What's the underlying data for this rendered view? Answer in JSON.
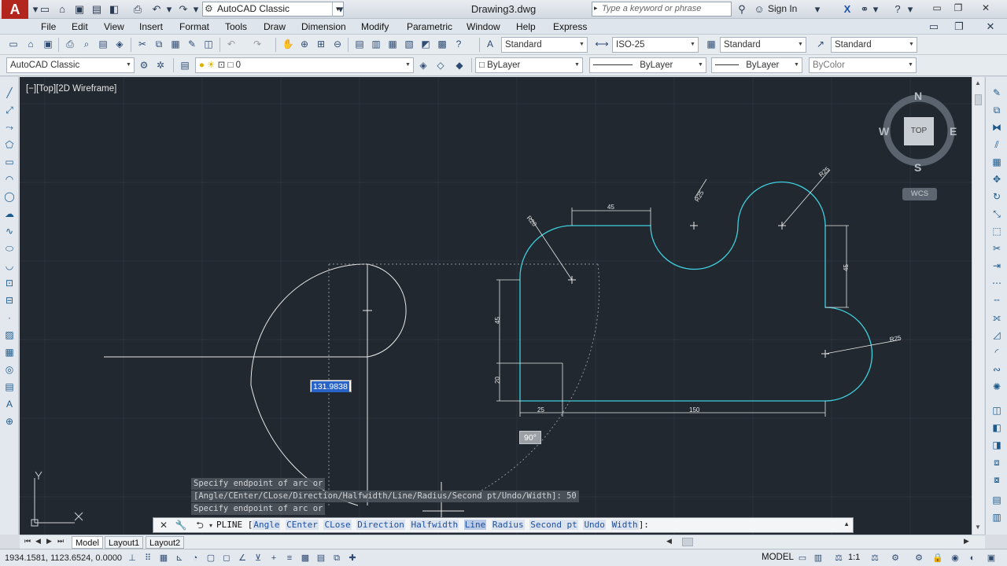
{
  "app": {
    "workspace": "AutoCAD Classic",
    "document_title": "Drawing3.dwg",
    "search_placeholder": "Type a keyword or phrase",
    "signin_label": "Sign In"
  },
  "menu": [
    "File",
    "Edit",
    "View",
    "Insert",
    "Format",
    "Tools",
    "Draw",
    "Dimension",
    "Modify",
    "Parametric",
    "Window",
    "Help",
    "Express"
  ],
  "styles": {
    "text_style": "Standard",
    "dim_style": "ISO-25",
    "table_style": "Standard",
    "mleader_style": "Standard"
  },
  "toolbar2": {
    "workspace": "AutoCAD Classic",
    "layer": "0",
    "color": "ByLayer",
    "linetype": "ByLayer",
    "lineweight": "ByLayer",
    "plotstyle": "ByColor"
  },
  "viewport": {
    "label": "[−][Top][2D Wireframe]",
    "dyn_input_value": "131.9838",
    "angle_tooltip": "90°",
    "compass": {
      "n": "N",
      "s": "S",
      "e": "E",
      "w": "W",
      "top": "TOP"
    },
    "wcs": "WCS"
  },
  "dimensions": {
    "d45_top": "45",
    "r20": "R20",
    "r25_mid": "R25",
    "r25_right": "R25",
    "d45_right": "45",
    "r25_lower": "R25",
    "d45_left": "45",
    "d20": "20",
    "d25": "25",
    "d150": "150"
  },
  "command_history": [
    "Specify endpoint of arc or",
    "[Angle/CEnter/CLose/Direction/Halfwidth/Line/Radius/Second pt/Undo/Width]: 50",
    "Specify endpoint of arc or"
  ],
  "command_line": {
    "command": "PLINE [",
    "options": [
      "Angle",
      "CEnter",
      "CLose",
      "Direction",
      "Halfwidth",
      "Line",
      "Radius",
      "Second pt",
      "Undo",
      "Width"
    ],
    "suffix": "]:"
  },
  "layout_tabs": [
    "Model",
    "Layout1",
    "Layout2"
  ],
  "status": {
    "coordinates": "1934.1581, 1123.6524, 0.0000",
    "space": "MODEL",
    "scale": "1:1"
  },
  "colors": {
    "viewport_bg": "#212830",
    "profile_cyan": "#3fd0de",
    "arc_white": "#e8e8e8",
    "selection_blue": "#2a63c8"
  }
}
